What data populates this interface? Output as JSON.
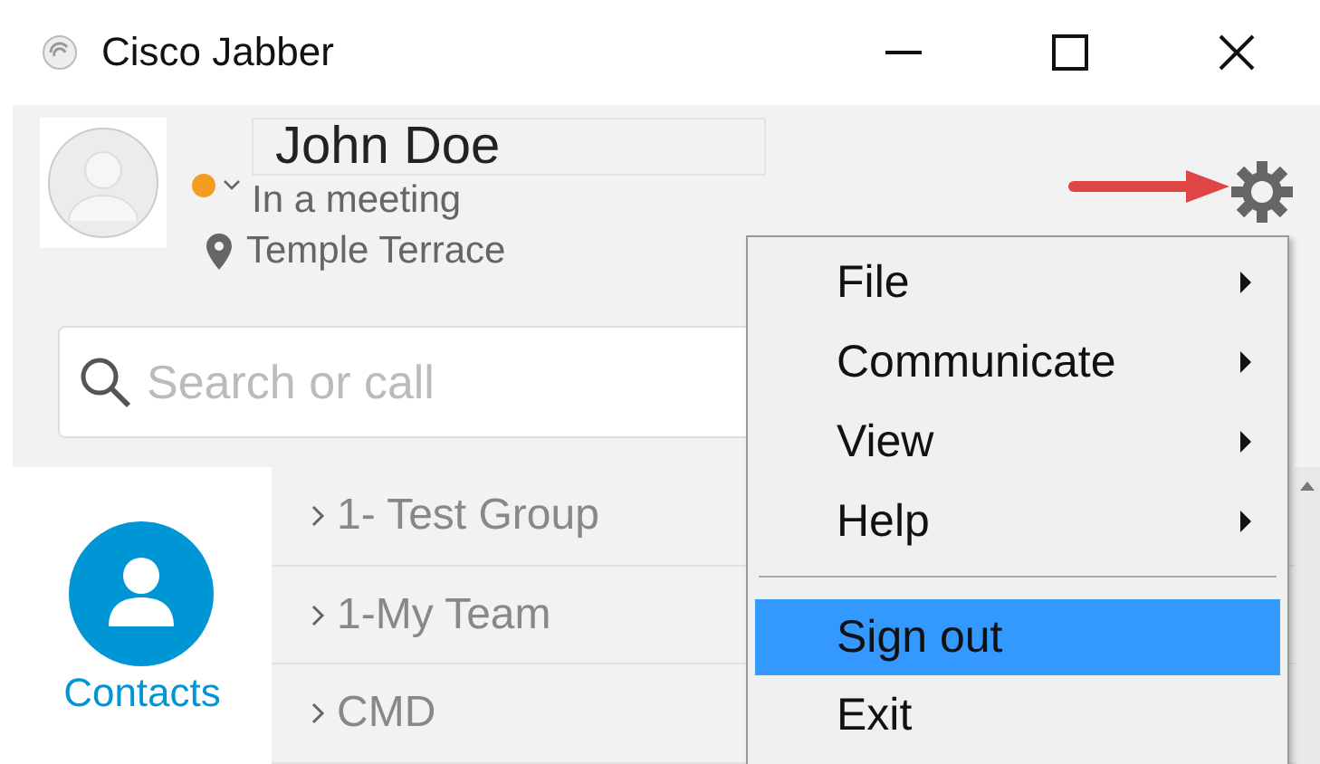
{
  "window": {
    "title": "Cisco Jabber"
  },
  "user": {
    "name": "John Doe",
    "status": "In a meeting",
    "color": "#f39c1f",
    "location": "Temple Terrace"
  },
  "search": {
    "placeholder": "Search or call"
  },
  "nav": [
    {
      "label": "Contacts",
      "selected": true
    }
  ],
  "groups": [
    {
      "label": "1- Test Group",
      "expanded": false
    },
    {
      "label": "1-My Team",
      "expanded": false
    },
    {
      "label": "CMD",
      "expanded": false
    }
  ],
  "menu": [
    {
      "label": "File",
      "submenu": true,
      "selected": false,
      "separator_before": false
    },
    {
      "label": "Communicate",
      "submenu": true,
      "selected": false,
      "separator_before": false
    },
    {
      "label": "View",
      "submenu": true,
      "selected": false,
      "separator_before": false
    },
    {
      "label": "Help",
      "submenu": true,
      "selected": false,
      "separator_before": false
    },
    {
      "label": "Sign out",
      "submenu": false,
      "selected": true,
      "separator_before": true
    },
    {
      "label": "Exit",
      "submenu": false,
      "selected": false,
      "separator_before": false
    }
  ]
}
